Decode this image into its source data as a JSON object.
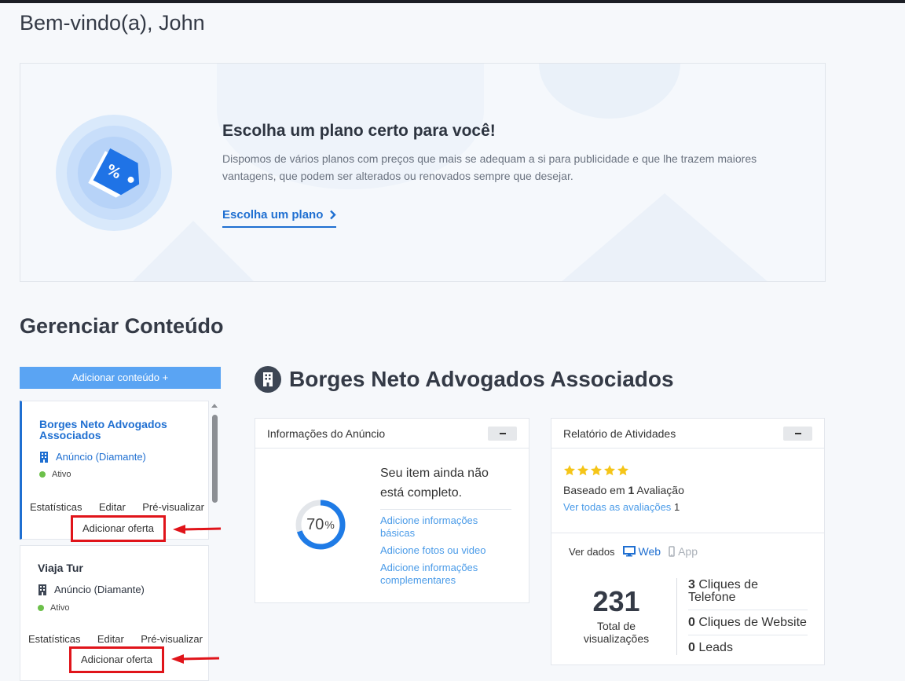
{
  "header": {
    "welcome": "Bem-vindo(a), John"
  },
  "banner": {
    "title": "Escolha um plano certo para você!",
    "text": "Dispomos de vários planos com preços que mais se adequam a si para publicidade e que lhe trazem maiores vantagens, que podem ser alterados ou renovados sempre que desejar.",
    "link": "Escolha um plano"
  },
  "manage": {
    "title": "Gerenciar Conteúdo",
    "add_button": "Adicionar conteúdo +"
  },
  "listings": [
    {
      "title": "Borges Neto Advogados Associados",
      "type": "Anúncio (Diamante)",
      "status": "Ativo",
      "actions": [
        "Estatísticas",
        "Editar",
        "Pré-visualizar"
      ],
      "offer": "Adicionar oferta"
    },
    {
      "title": "Viaja Tur",
      "type": "Anúncio (Diamante)",
      "status": "Ativo",
      "actions": [
        "Estatísticas",
        "Editar",
        "Pré-visualizar"
      ],
      "offer": "Adicionar oferta"
    }
  ],
  "selected": {
    "title": "Borges Neto Advogados Associados"
  },
  "info_panel": {
    "title": "Informações do Anúncio",
    "progress_value": "70",
    "progress_unit": "%",
    "progress_fraction": 0.7,
    "incomplete": "Seu item ainda não está completo.",
    "tips": [
      "Adicione informações básicas",
      "Adicione fotos ou video",
      "Adicione informações complementares"
    ]
  },
  "activity_panel": {
    "title": "Relatório de Atividades",
    "rating_stars": 5,
    "based_prefix": "Baseado em",
    "based_count": "1",
    "based_suffix": "Avaliação",
    "see_all": "Ver todas as avaliações",
    "see_all_count": "1",
    "view_data": "Ver dados",
    "web": "Web",
    "app": "App",
    "total": "231",
    "total_label": "Total de visualizações",
    "metrics": [
      {
        "count": "3",
        "label": "Cliques de Telefone"
      },
      {
        "count": "0",
        "label": "Cliques de Website"
      },
      {
        "count": "0",
        "label": "Leads"
      }
    ]
  },
  "colors": {
    "accent": "#1f6fd1",
    "link": "#4a9be8",
    "highlight": "#e0141a",
    "active": "#6cc04a",
    "star": "#f5c518"
  }
}
